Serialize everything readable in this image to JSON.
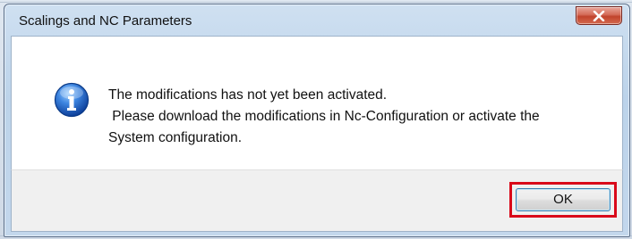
{
  "dialog": {
    "title": "Scalings and NC Parameters",
    "icon": "information-icon",
    "message_lines": [
      "The modifications has not yet been activated.",
      " Please download the modifications in Nc-Configuration or activate the",
      "System configuration."
    ],
    "ok_label": "OK",
    "close_icon": "close-icon",
    "highlight_color": "#d9091a"
  }
}
